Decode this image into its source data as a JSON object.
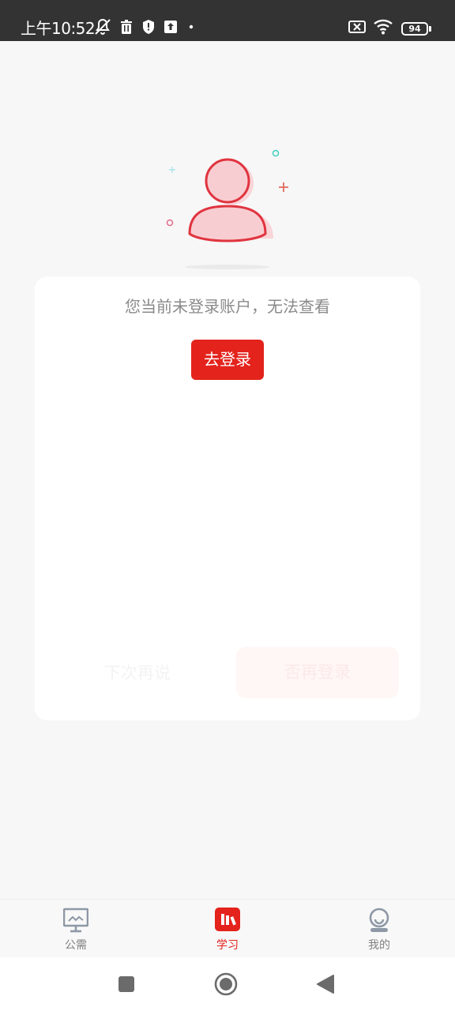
{
  "status_bar": {
    "time": "上午10:52",
    "battery_level": "94",
    "icons_left": [
      "notifications-off-icon",
      "trash-icon",
      "shield-icon",
      "upload-icon",
      "dot-icon"
    ],
    "icons_right": [
      "sim-off-icon",
      "wifi-icon",
      "battery-icon"
    ]
  },
  "main": {
    "illustration_icon": "user-avatar-icon",
    "message": "您当前未登录账户，无法查看",
    "login_button": "去登录",
    "later_button": "下次再说",
    "retry_button": "否再登录"
  },
  "tab_bar": {
    "tabs": [
      {
        "label": "公需",
        "icon": "monitor-chart-icon",
        "active": false
      },
      {
        "label": "学习",
        "icon": "books-icon",
        "active": true
      },
      {
        "label": "我的",
        "icon": "profile-icon",
        "active": false
      }
    ]
  },
  "colors": {
    "accent": "#e3231c",
    "status_bar": "#333333",
    "background": "#f7f7f7",
    "inactive_tab": "#808080"
  },
  "system_nav": [
    "recent-apps-icon",
    "home-icon",
    "back-icon"
  ]
}
